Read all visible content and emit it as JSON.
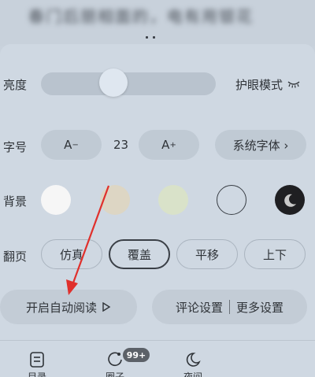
{
  "book": {
    "blurred_text": "春门后朋相面的，电有用银花"
  },
  "brightness": {
    "label": "亮度",
    "level": 0.41,
    "eye_mode_label": "护眼模式"
  },
  "font_size": {
    "label": "字号",
    "decrease_label": "A",
    "decrease_sup": "−",
    "value": "23",
    "increase_label": "A",
    "increase_sup": "+",
    "system_font_label": "系统字体 ›"
  },
  "background": {
    "label": "背景",
    "swatches": [
      "#f6f6f6",
      "#ddd6c4",
      "#d9e2c9",
      "transparent",
      "#1f1f22"
    ]
  },
  "page_turn": {
    "label": "翻页",
    "options": [
      "仿真",
      "覆盖",
      "平移",
      "上下"
    ],
    "selected": "覆盖"
  },
  "actions": {
    "auto_read_label": "开启自动阅读",
    "comment_settings_label": "评论设置",
    "more_settings_label": "更多设置"
  },
  "bottom_bar": {
    "tabs": [
      "目录",
      "圈子",
      "夜间"
    ],
    "badge": "99+"
  },
  "colors": {
    "panel": "#cfd8e2",
    "arrow": "#e0302c"
  }
}
